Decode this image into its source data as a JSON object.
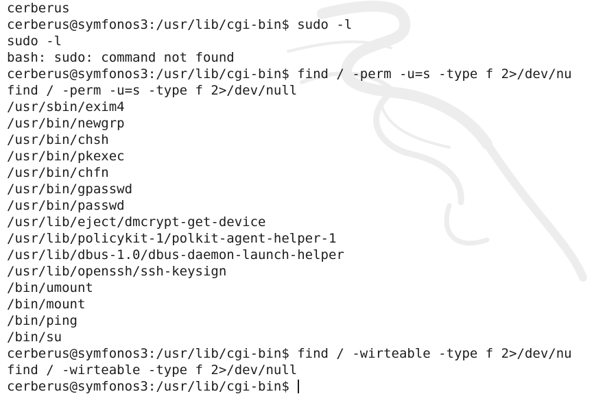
{
  "terminal": {
    "lines": [
      "cerberus",
      "cerberus@symfonos3:/usr/lib/cgi-bin$ sudo -l",
      "sudo -l",
      "bash: sudo: command not found",
      "cerberus@symfonos3:/usr/lib/cgi-bin$ find / -perm -u=s -type f 2>/dev/nu",
      "find / -perm -u=s -type f 2>/dev/null",
      "/usr/sbin/exim4",
      "/usr/bin/newgrp",
      "/usr/bin/chsh",
      "/usr/bin/pkexec",
      "/usr/bin/chfn",
      "/usr/bin/gpasswd",
      "/usr/bin/passwd",
      "/usr/lib/eject/dmcrypt-get-device",
      "/usr/lib/policykit-1/polkit-agent-helper-1",
      "/usr/lib/dbus-1.0/dbus-daemon-launch-helper",
      "/usr/lib/openssh/ssh-keysign",
      "/bin/umount",
      "/bin/mount",
      "/bin/ping",
      "/bin/su",
      "cerberus@symfonos3:/usr/lib/cgi-bin$ find / -wirteable -type f 2>/dev/nu",
      "find / -wirteable -type f 2>/dev/null"
    ],
    "current_prompt": "cerberus@symfonos3:/usr/lib/cgi-bin$"
  },
  "colors": {
    "background": "#ffffff",
    "text": "#1c1c1c",
    "watermark": "#ededed"
  },
  "icons": {
    "watermark": "kali-dragon-icon"
  }
}
